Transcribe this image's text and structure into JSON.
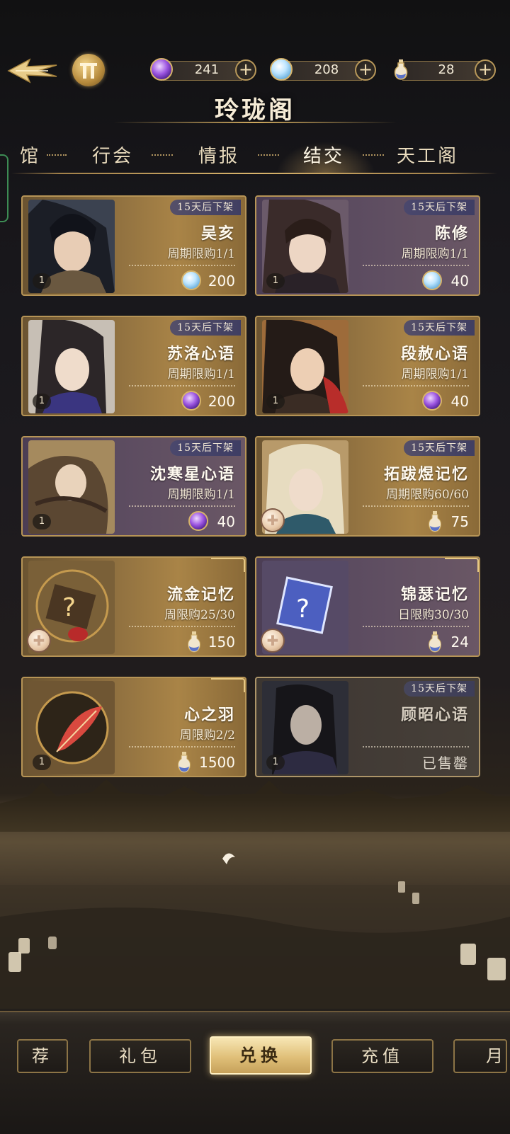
{
  "header": {
    "title": "玲珑阁",
    "resources": [
      {
        "icon": "purple-gem-icon",
        "value": "241"
      },
      {
        "icon": "blue-gem-icon",
        "value": "208"
      },
      {
        "icon": "bottle-icon",
        "value": "28"
      }
    ]
  },
  "tabs": [
    {
      "label": "馆",
      "active": false
    },
    {
      "label": "行会",
      "active": false
    },
    {
      "label": "情报",
      "active": false
    },
    {
      "label": "结交",
      "active": true
    },
    {
      "label": "天工阁",
      "active": false
    }
  ],
  "items": [
    {
      "name": "吴亥",
      "timer": "15天后下架",
      "limit": "周期限购1/1",
      "price": "200",
      "currency": "blue-gem",
      "qty": "1",
      "style": "gold"
    },
    {
      "name": "陈修",
      "timer": "15天后下架",
      "limit": "周期限购1/1",
      "price": "40",
      "currency": "blue-gem",
      "qty": "1",
      "style": "purple"
    },
    {
      "name": "苏洛心语",
      "timer": "15天后下架",
      "limit": "周期限购1/1",
      "price": "200",
      "currency": "purple-gem",
      "qty": "1",
      "style": "gold"
    },
    {
      "name": "段赦心语",
      "timer": "15天后下架",
      "limit": "周期限购1/1",
      "price": "40",
      "currency": "purple-gem",
      "qty": "1",
      "style": "gold"
    },
    {
      "name": "沈寒星心语",
      "timer": "15天后下架",
      "limit": "周期限购1/1",
      "price": "40",
      "currency": "purple-gem",
      "qty": "1",
      "style": "purple"
    },
    {
      "name": "拓跋煜记忆",
      "timer": "15天后下架",
      "limit": "周期限购60/60",
      "price": "75",
      "currency": "bottle",
      "qty": "",
      "style": "gold"
    },
    {
      "name": "流金记忆",
      "timer": "",
      "limit": "周限购25/30",
      "price": "150",
      "currency": "bottle",
      "qty": "",
      "style": "gold"
    },
    {
      "name": "锦瑟记忆",
      "timer": "",
      "limit": "日限购30/30",
      "price": "24",
      "currency": "bottle",
      "qty": "",
      "style": "purple"
    },
    {
      "name": "心之羽",
      "timer": "",
      "limit": "周限购2/2",
      "price": "1500",
      "currency": "bottle",
      "qty": "1",
      "style": "gold"
    },
    {
      "name": "顾昭心语",
      "timer": "15天后下架",
      "limit": "",
      "price": "",
      "currency": "",
      "qty": "1",
      "style": "sold",
      "status": "已售罄"
    }
  ],
  "bottom_nav": [
    {
      "label": "荐",
      "active": false
    },
    {
      "label": "礼包",
      "active": false
    },
    {
      "label": "兑换",
      "active": true
    },
    {
      "label": "充值",
      "active": false
    },
    {
      "label": "月",
      "active": false
    }
  ]
}
